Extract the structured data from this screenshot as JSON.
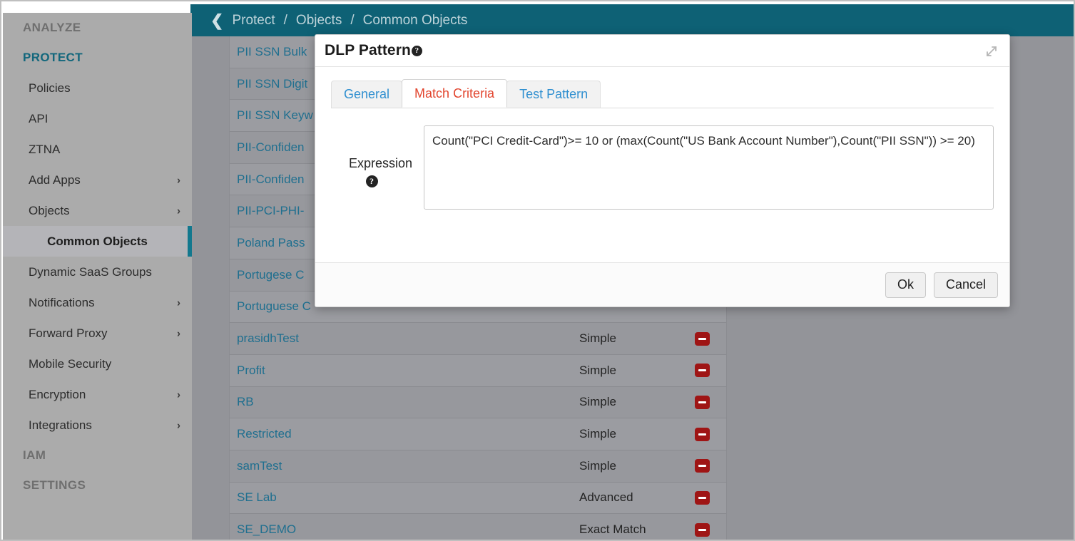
{
  "theme": {
    "teal": "#0e6175",
    "sidebar_bg": "#ababab",
    "overlay_gray": "#939499",
    "link_blue": "#1f6f8f",
    "tab_blue": "#2f8fd0",
    "tab_active_red": "#e2462f",
    "delete_red": "#9f1515",
    "active_bar_teal": "#12788e"
  },
  "breadcrumb": {
    "back_icon": "chevron-left-icon",
    "parts": [
      "Protect",
      "Objects",
      "Common Objects"
    ],
    "separator": "/"
  },
  "sidebar": {
    "items": [
      {
        "label": "ANALYZE",
        "kind": "section",
        "active": false,
        "chevron": ""
      },
      {
        "label": "PROTECT",
        "kind": "section",
        "active": true,
        "chevron": ""
      },
      {
        "label": "Policies",
        "kind": "item",
        "active": false,
        "chevron": ""
      },
      {
        "label": "API",
        "kind": "item",
        "active": false,
        "chevron": ""
      },
      {
        "label": "ZTNA",
        "kind": "item",
        "active": false,
        "chevron": ""
      },
      {
        "label": "Add Apps",
        "kind": "item",
        "active": false,
        "chevron": "›"
      },
      {
        "label": "Objects",
        "kind": "item",
        "active": false,
        "chevron": "›"
      },
      {
        "label": "Common Objects",
        "kind": "selected",
        "active": false,
        "chevron": ""
      },
      {
        "label": "Dynamic SaaS Groups",
        "kind": "item",
        "active": false,
        "chevron": ""
      },
      {
        "label": "Notifications",
        "kind": "item",
        "active": false,
        "chevron": "›"
      },
      {
        "label": "Forward Proxy",
        "kind": "item",
        "active": false,
        "chevron": "›"
      },
      {
        "label": "Mobile Security",
        "kind": "item",
        "active": false,
        "chevron": ""
      },
      {
        "label": "Encryption",
        "kind": "item",
        "active": false,
        "chevron": "›"
      },
      {
        "label": "Integrations",
        "kind": "item",
        "active": false,
        "chevron": "›"
      },
      {
        "label": "IAM",
        "kind": "section",
        "active": false,
        "chevron": ""
      },
      {
        "label": "SETTINGS",
        "kind": "section",
        "active": false,
        "chevron": ""
      }
    ]
  },
  "table": {
    "rows": [
      {
        "name": "PII SSN Bulk",
        "type": ""
      },
      {
        "name": "PII SSN Digit",
        "type": ""
      },
      {
        "name": "PII SSN Keyw",
        "type": ""
      },
      {
        "name": "PII-Confiden",
        "type": ""
      },
      {
        "name": "PII-Confiden",
        "type": ""
      },
      {
        "name": "PII-PCI-PHI-",
        "type": ""
      },
      {
        "name": "Poland Pass",
        "type": ""
      },
      {
        "name": "Portugese C",
        "type": ""
      },
      {
        "name": "Portuguese C",
        "type": ""
      },
      {
        "name": "prasidhTest",
        "type": "Simple"
      },
      {
        "name": "Profit",
        "type": "Simple"
      },
      {
        "name": "RB",
        "type": "Simple"
      },
      {
        "name": "Restricted",
        "type": "Simple"
      },
      {
        "name": "samTest",
        "type": "Simple"
      },
      {
        "name": "SE Lab",
        "type": "Advanced"
      },
      {
        "name": "SE_DEMO",
        "type": "Exact Match"
      }
    ],
    "delete_icon": "delete-minus-icon"
  },
  "modal": {
    "title": "DLP Pattern",
    "title_help_glyph": "?",
    "expand_icon": "expand-diagonal-icon",
    "tabs": [
      {
        "label": "General",
        "active": false
      },
      {
        "label": "Match Criteria",
        "active": true
      },
      {
        "label": "Test Pattern",
        "active": false
      }
    ],
    "form": {
      "expression_label": "Expression",
      "expression_help_glyph": "?",
      "expression_value": "Count(\"PCI Credit-Card\")>= 10 or (max(Count(\"US Bank Account Number\"),Count(\"PII SSN\")) >= 20)",
      "expression_placeholder": ""
    },
    "buttons": {
      "ok": "Ok",
      "cancel": "Cancel"
    }
  }
}
